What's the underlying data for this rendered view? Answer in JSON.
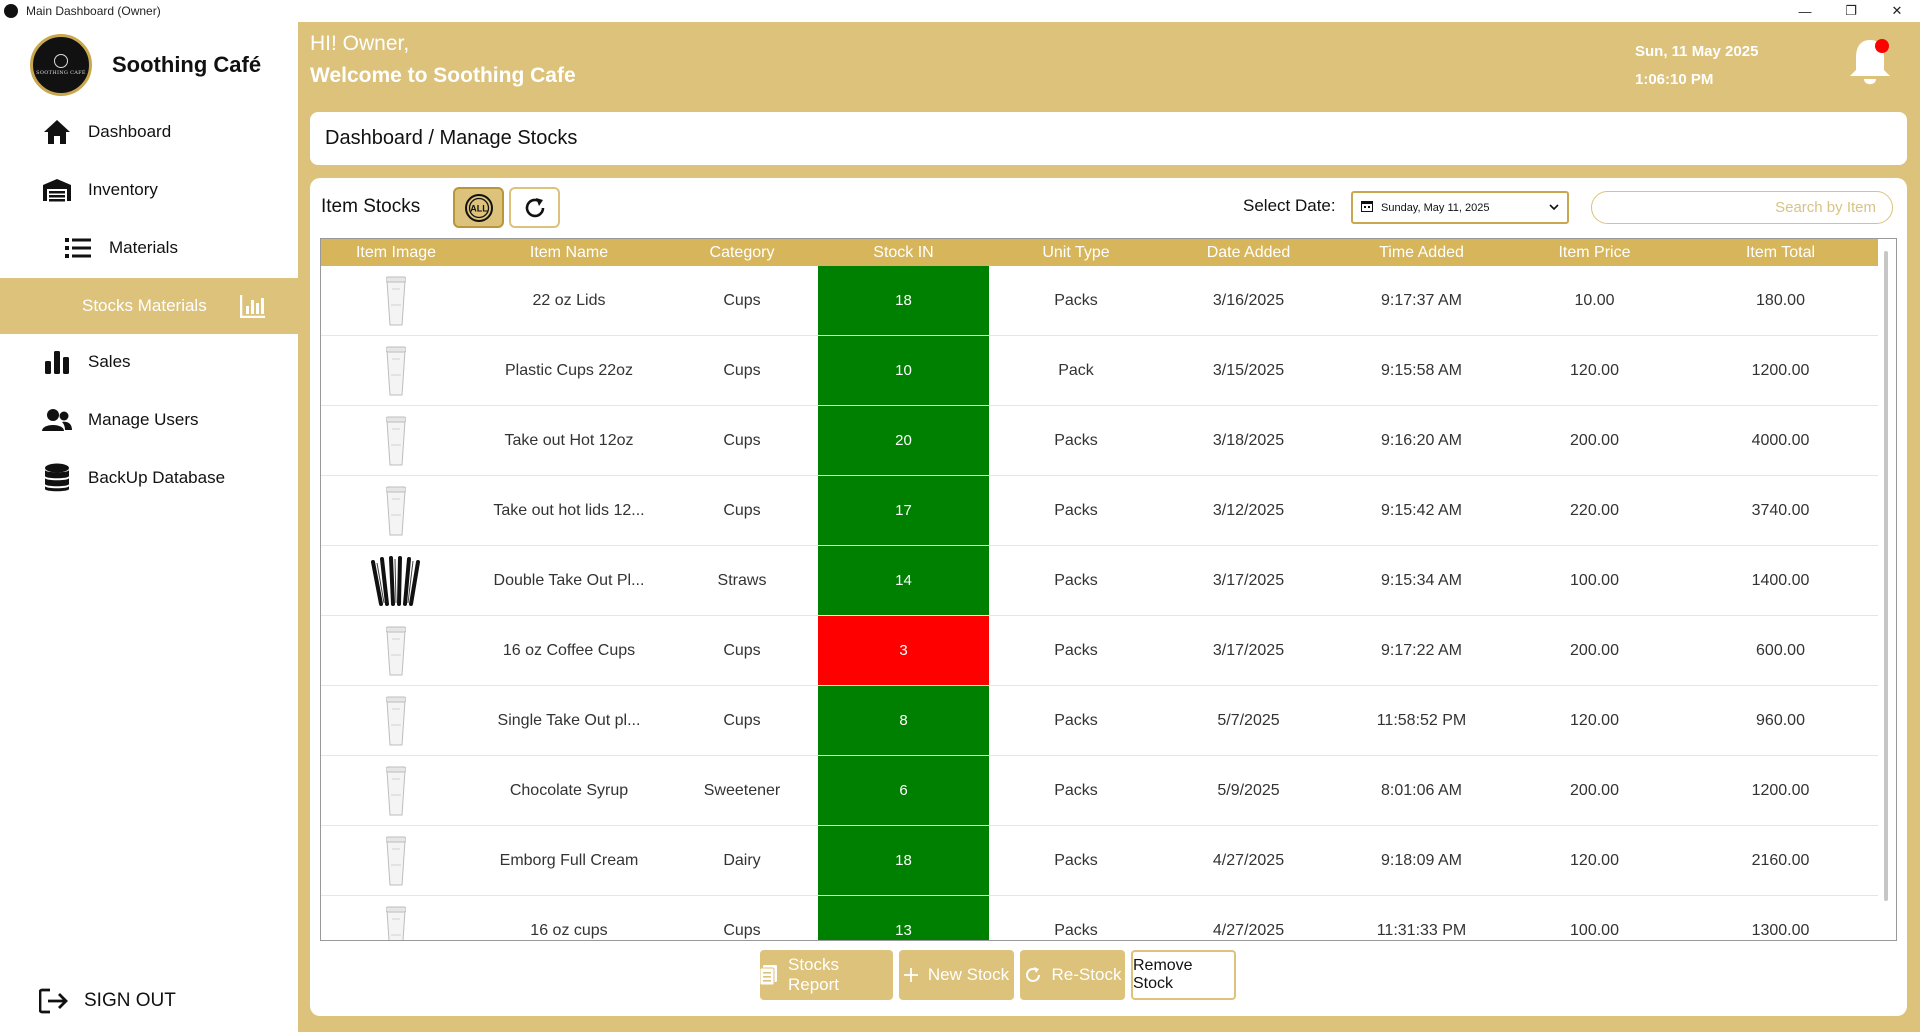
{
  "window": {
    "title": "Main Dashboard (Owner)",
    "controls": [
      "—",
      "❐",
      "✕"
    ]
  },
  "sidebar": {
    "brand": "Soothing Café",
    "logo_text": "SOOTHING CAFÉ",
    "items": [
      {
        "label": "Dashboard",
        "icon": "home-icon"
      },
      {
        "label": "Inventory",
        "icon": "warehouse-icon"
      },
      {
        "label": "Materials",
        "icon": "list-icon"
      },
      {
        "label": "Stocks Materials",
        "icon": "bar-chart-icon"
      },
      {
        "label": "Sales",
        "icon": "bars-icon"
      },
      {
        "label": "Manage Users",
        "icon": "users-icon"
      },
      {
        "label": "BackUp Database",
        "icon": "database-icon"
      }
    ],
    "signout": "SIGN OUT"
  },
  "header": {
    "greeting": "HI! Owner,",
    "welcome": "Welcome to Soothing Cafe",
    "date": "Sun, 11 May 2025",
    "time": "1:06:10 PM"
  },
  "breadcrumb": "Dashboard / Manage Stocks",
  "panel": {
    "title": "Item Stocks",
    "all_button": "ALL",
    "date_label": "Select Date:",
    "date_value": "Sunday, May 11, 2025",
    "search_placeholder": "Search by Item"
  },
  "table": {
    "headers": [
      "Item Image",
      "Item Name",
      "Category",
      "Stock IN",
      "Unit Type",
      "Date Added",
      "Time Added",
      "Item Price",
      "Item Total"
    ],
    "rows": [
      [
        "cup",
        "22 oz Lids",
        "Cups",
        "18",
        "Packs",
        "3/16/2025",
        "9:17:37 AM",
        "10.00",
        "180.00"
      ],
      [
        "cup",
        "Plastic Cups 22oz",
        "Cups",
        "10",
        "Pack",
        "3/15/2025",
        "9:15:58 AM",
        "120.00",
        "1200.00"
      ],
      [
        "cup",
        "Take out Hot 12oz",
        "Cups",
        "20",
        "Packs",
        "3/18/2025",
        "9:16:20 AM",
        "200.00",
        "4000.00"
      ],
      [
        "cup",
        "Take out hot lids 12...",
        "Cups",
        "17",
        "Packs",
        "3/12/2025",
        "9:15:42 AM",
        "220.00",
        "3740.00"
      ],
      [
        "straws",
        "Double Take Out Pl...",
        "Straws",
        "14",
        "Packs",
        "3/17/2025",
        "9:15:34 AM",
        "100.00",
        "1400.00"
      ],
      [
        "cup",
        "16 oz Coffee Cups",
        "Cups",
        "3",
        "Packs",
        "3/17/2025",
        "9:17:22 AM",
        "200.00",
        "600.00"
      ],
      [
        "cup",
        "Single Take Out pl...",
        "Cups",
        "8",
        "Packs",
        "5/7/2025",
        "11:58:52 PM",
        "120.00",
        "960.00"
      ],
      [
        "cup",
        "Chocolate Syrup",
        "Sweetener",
        "6",
        "Packs",
        "5/9/2025",
        "8:01:06 AM",
        "200.00",
        "1200.00"
      ],
      [
        "cup",
        "Emborg Full Cream",
        "Dairy",
        "18",
        "Packs",
        "4/27/2025",
        "9:18:09 AM",
        "120.00",
        "2160.00"
      ],
      [
        "cup",
        "16 oz cups",
        "Cups",
        "13",
        "Packs",
        "4/27/2025",
        "11:31:33 PM",
        "100.00",
        "1300.00"
      ]
    ],
    "low_stock_color": "#ff0000",
    "ok_stock_color": "#008000"
  },
  "actions": {
    "report": "Stocks Report",
    "new": "New Stock",
    "restock": "Re-Stock",
    "remove": "Remove Stock"
  },
  "colors": {
    "accent": "#dcc27b",
    "header_gold": "#d7b55b"
  }
}
